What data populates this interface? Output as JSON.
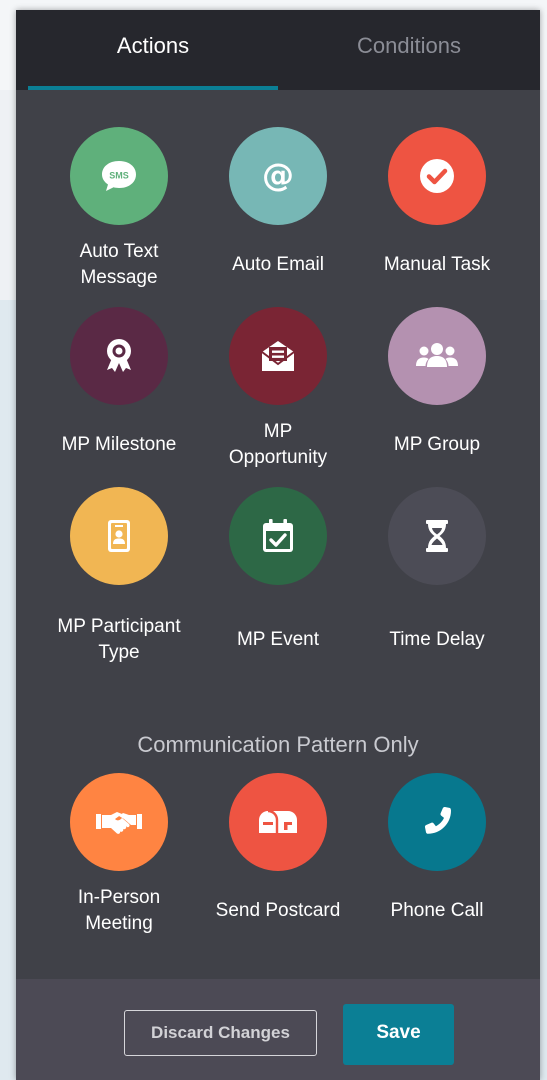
{
  "tabs": {
    "actions": "Actions",
    "conditions": "Conditions"
  },
  "items": [
    {
      "label": "Auto Text Message",
      "icon": "sms-bubble-icon",
      "color": "#5fb07b"
    },
    {
      "label": "Auto Email",
      "icon": "at-sign-icon",
      "color": "#77b7b5"
    },
    {
      "label": "Manual Task",
      "icon": "check-circle-icon",
      "color": "#ee5442"
    },
    {
      "label": "MP Milestone",
      "icon": "award-ribbon-icon",
      "color": "#5a2945"
    },
    {
      "label": "MP Opportunity",
      "icon": "envelope-open-icon",
      "color": "#7a2534"
    },
    {
      "label": "MP Group",
      "icon": "users-group-icon",
      "color": "#b491b0"
    },
    {
      "label": "MP Participant Type",
      "icon": "id-badge-icon",
      "color": "#f1b653"
    },
    {
      "label": "MP Event",
      "icon": "calendar-check-icon",
      "color": "#2d6846"
    },
    {
      "label": "Time Delay",
      "icon": "hourglass-icon",
      "color": "#4c4c56"
    }
  ],
  "section_title": "Communication Pattern Only",
  "comm_items": [
    {
      "label": "In-Person Meeting",
      "icon": "handshake-icon",
      "color": "#ff8442"
    },
    {
      "label": "Send Postcard",
      "icon": "mailbox-icon",
      "color": "#ee5442"
    },
    {
      "label": "Phone Call",
      "icon": "phone-icon",
      "color": "#07788e"
    }
  ],
  "buttons": {
    "discard": "Discard Changes",
    "save": "Save"
  }
}
